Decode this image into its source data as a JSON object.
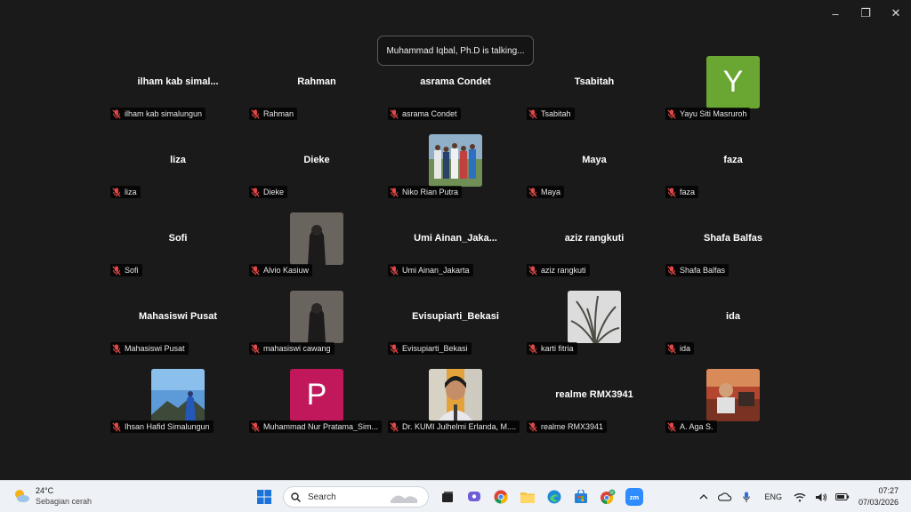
{
  "meeting": {
    "speaker_banner": "Muhammad Iqbal, Ph.D is talking..."
  },
  "colors": {
    "tile_Y": "#6aa632",
    "tile_P": "#c0185a",
    "grid_bg": "#1a1a1a"
  },
  "participants": [
    {
      "display": "ilham  kab  simal...",
      "label": "ilham kab simalungun",
      "muted": true
    },
    {
      "display": "Rahman",
      "label": "Rahman",
      "muted": true
    },
    {
      "display": "asrama Condet",
      "label": "asrama Condet",
      "muted": true
    },
    {
      "display": "Tsabitah",
      "label": "Tsabitah",
      "muted": true
    },
    {
      "letter": "Y",
      "label": "Yayu Siti Masruroh",
      "muted": true
    },
    {
      "display": "liza",
      "label": "liza",
      "muted": true
    },
    {
      "display": "Dieke",
      "label": "Dieke",
      "muted": true
    },
    {
      "photo": "group-photo",
      "label": "Niko Rian Putra",
      "muted": true
    },
    {
      "display": "Maya",
      "label": "Maya",
      "muted": true
    },
    {
      "display": "faza",
      "label": "faza",
      "muted": true
    },
    {
      "display": "Sofi",
      "label": "Sofi",
      "muted": true
    },
    {
      "photo": "hijab-photo",
      "label": "Alvio Kasiuw",
      "muted": true
    },
    {
      "display": "Umi  Ainan_Jaka...",
      "label": "Umi Ainan_Jakarta",
      "muted": true
    },
    {
      "display": "aziz rangkuti",
      "label": "aziz rangkuti",
      "muted": true
    },
    {
      "display": "Shafa Balfas",
      "label": "Shafa Balfas",
      "muted": true
    },
    {
      "display": "Mahasiswi Pusat",
      "label": "Mahasiswi Pusat",
      "muted": true
    },
    {
      "photo": "hijab-photo",
      "label": "mahasiswi cawang",
      "muted": true
    },
    {
      "display": "Evisupiarti_Bekasi",
      "label": "Evisupiarti_Bekasi",
      "muted": true
    },
    {
      "photo": "plant-photo",
      "label": "karti fitria",
      "muted": true
    },
    {
      "display": "ida",
      "label": "ida",
      "muted": true
    },
    {
      "photo": "mountain-photo",
      "label": "Ihsan Hafid Simalungun",
      "muted": true
    },
    {
      "letter": "P",
      "label": "Muhammad Nur Pratama_Sim...",
      "muted": true
    },
    {
      "photo": "portrait-photo",
      "label": "Dr. KUMI Julhelmi Erlanda, M....",
      "muted": true
    },
    {
      "display": "realme RMX3941",
      "label": "realme RMX3941",
      "muted": true
    },
    {
      "photo": "workshop-photo",
      "label": "A. Aga S.",
      "muted": true
    }
  ],
  "taskbar": {
    "weather_temp": "24°C",
    "weather_desc": "Sebagian cerah",
    "search_placeholder": "Search",
    "language": "ENG",
    "time": "07:27",
    "date": "07/03/2026",
    "icons": [
      "start-icon",
      "task-view-icon",
      "chat-icon",
      "chrome-icon",
      "file-explorer-icon",
      "edge-icon",
      "store-icon",
      "chrome-profile-icon",
      "zoom-icon"
    ]
  }
}
